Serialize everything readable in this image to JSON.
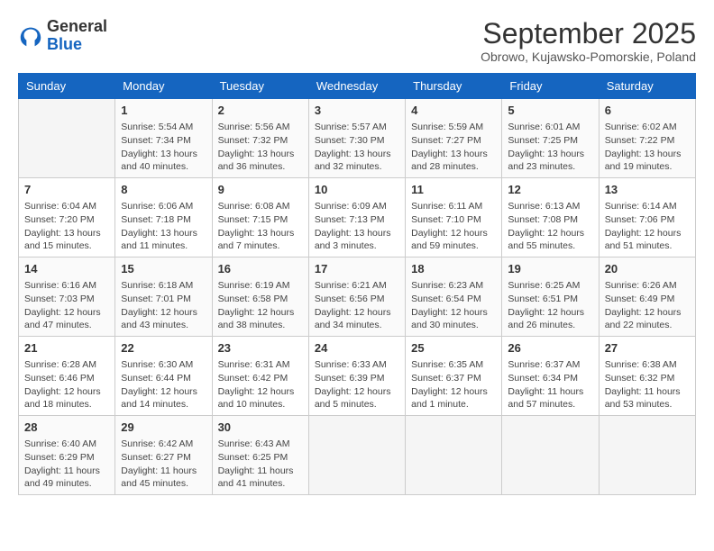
{
  "header": {
    "logo_line1": "General",
    "logo_line2": "Blue",
    "month_title": "September 2025",
    "location": "Obrowo, Kujawsko-Pomorskie, Poland"
  },
  "days_of_week": [
    "Sunday",
    "Monday",
    "Tuesday",
    "Wednesday",
    "Thursday",
    "Friday",
    "Saturday"
  ],
  "weeks": [
    [
      {
        "day": "",
        "info": ""
      },
      {
        "day": "1",
        "info": "Sunrise: 5:54 AM\nSunset: 7:34 PM\nDaylight: 13 hours and 40 minutes."
      },
      {
        "day": "2",
        "info": "Sunrise: 5:56 AM\nSunset: 7:32 PM\nDaylight: 13 hours and 36 minutes."
      },
      {
        "day": "3",
        "info": "Sunrise: 5:57 AM\nSunset: 7:30 PM\nDaylight: 13 hours and 32 minutes."
      },
      {
        "day": "4",
        "info": "Sunrise: 5:59 AM\nSunset: 7:27 PM\nDaylight: 13 hours and 28 minutes."
      },
      {
        "day": "5",
        "info": "Sunrise: 6:01 AM\nSunset: 7:25 PM\nDaylight: 13 hours and 23 minutes."
      },
      {
        "day": "6",
        "info": "Sunrise: 6:02 AM\nSunset: 7:22 PM\nDaylight: 13 hours and 19 minutes."
      }
    ],
    [
      {
        "day": "7",
        "info": "Sunrise: 6:04 AM\nSunset: 7:20 PM\nDaylight: 13 hours and 15 minutes."
      },
      {
        "day": "8",
        "info": "Sunrise: 6:06 AM\nSunset: 7:18 PM\nDaylight: 13 hours and 11 minutes."
      },
      {
        "day": "9",
        "info": "Sunrise: 6:08 AM\nSunset: 7:15 PM\nDaylight: 13 hours and 7 minutes."
      },
      {
        "day": "10",
        "info": "Sunrise: 6:09 AM\nSunset: 7:13 PM\nDaylight: 13 hours and 3 minutes."
      },
      {
        "day": "11",
        "info": "Sunrise: 6:11 AM\nSunset: 7:10 PM\nDaylight: 12 hours and 59 minutes."
      },
      {
        "day": "12",
        "info": "Sunrise: 6:13 AM\nSunset: 7:08 PM\nDaylight: 12 hours and 55 minutes."
      },
      {
        "day": "13",
        "info": "Sunrise: 6:14 AM\nSunset: 7:06 PM\nDaylight: 12 hours and 51 minutes."
      }
    ],
    [
      {
        "day": "14",
        "info": "Sunrise: 6:16 AM\nSunset: 7:03 PM\nDaylight: 12 hours and 47 minutes."
      },
      {
        "day": "15",
        "info": "Sunrise: 6:18 AM\nSunset: 7:01 PM\nDaylight: 12 hours and 43 minutes."
      },
      {
        "day": "16",
        "info": "Sunrise: 6:19 AM\nSunset: 6:58 PM\nDaylight: 12 hours and 38 minutes."
      },
      {
        "day": "17",
        "info": "Sunrise: 6:21 AM\nSunset: 6:56 PM\nDaylight: 12 hours and 34 minutes."
      },
      {
        "day": "18",
        "info": "Sunrise: 6:23 AM\nSunset: 6:54 PM\nDaylight: 12 hours and 30 minutes."
      },
      {
        "day": "19",
        "info": "Sunrise: 6:25 AM\nSunset: 6:51 PM\nDaylight: 12 hours and 26 minutes."
      },
      {
        "day": "20",
        "info": "Sunrise: 6:26 AM\nSunset: 6:49 PM\nDaylight: 12 hours and 22 minutes."
      }
    ],
    [
      {
        "day": "21",
        "info": "Sunrise: 6:28 AM\nSunset: 6:46 PM\nDaylight: 12 hours and 18 minutes."
      },
      {
        "day": "22",
        "info": "Sunrise: 6:30 AM\nSunset: 6:44 PM\nDaylight: 12 hours and 14 minutes."
      },
      {
        "day": "23",
        "info": "Sunrise: 6:31 AM\nSunset: 6:42 PM\nDaylight: 12 hours and 10 minutes."
      },
      {
        "day": "24",
        "info": "Sunrise: 6:33 AM\nSunset: 6:39 PM\nDaylight: 12 hours and 5 minutes."
      },
      {
        "day": "25",
        "info": "Sunrise: 6:35 AM\nSunset: 6:37 PM\nDaylight: 12 hours and 1 minute."
      },
      {
        "day": "26",
        "info": "Sunrise: 6:37 AM\nSunset: 6:34 PM\nDaylight: 11 hours and 57 minutes."
      },
      {
        "day": "27",
        "info": "Sunrise: 6:38 AM\nSunset: 6:32 PM\nDaylight: 11 hours and 53 minutes."
      }
    ],
    [
      {
        "day": "28",
        "info": "Sunrise: 6:40 AM\nSunset: 6:29 PM\nDaylight: 11 hours and 49 minutes."
      },
      {
        "day": "29",
        "info": "Sunrise: 6:42 AM\nSunset: 6:27 PM\nDaylight: 11 hours and 45 minutes."
      },
      {
        "day": "30",
        "info": "Sunrise: 6:43 AM\nSunset: 6:25 PM\nDaylight: 11 hours and 41 minutes."
      },
      {
        "day": "",
        "info": ""
      },
      {
        "day": "",
        "info": ""
      },
      {
        "day": "",
        "info": ""
      },
      {
        "day": "",
        "info": ""
      }
    ]
  ]
}
